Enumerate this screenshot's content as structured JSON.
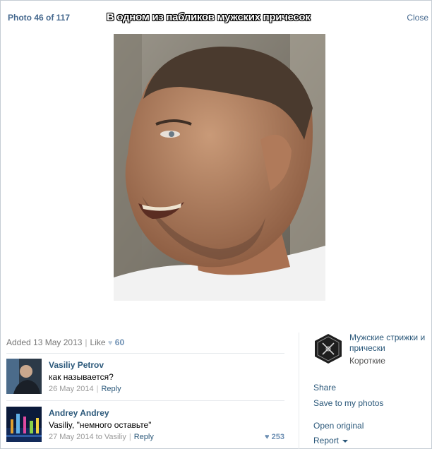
{
  "header": {
    "counter": "Photo 46 of 117",
    "caption": "В одном из пабликов мужских причесок",
    "close": "Close"
  },
  "meta": {
    "added": "Added 13 May 2013",
    "like": "Like",
    "likes_count": "60"
  },
  "comments": [
    {
      "author": "Vasiliy Petrov",
      "text": "как называется?",
      "date": "26 May 2014",
      "reply": "Reply"
    },
    {
      "author": "Andrey Andrey",
      "text": "Vasiliy, \"немного оставьте\"",
      "date": "27 May 2014 to Vasiliy",
      "reply": "Reply",
      "likes": "253"
    }
  ],
  "sidebar": {
    "group_name": "Мужские стрижки и прически",
    "album": "Короткие",
    "actions": {
      "share": "Share",
      "save": "Save to my photos",
      "open": "Open original",
      "report": "Report"
    }
  },
  "colors": {
    "link": "#2b587a",
    "header_link": "#45688e",
    "likes": "#6d8fb3"
  }
}
